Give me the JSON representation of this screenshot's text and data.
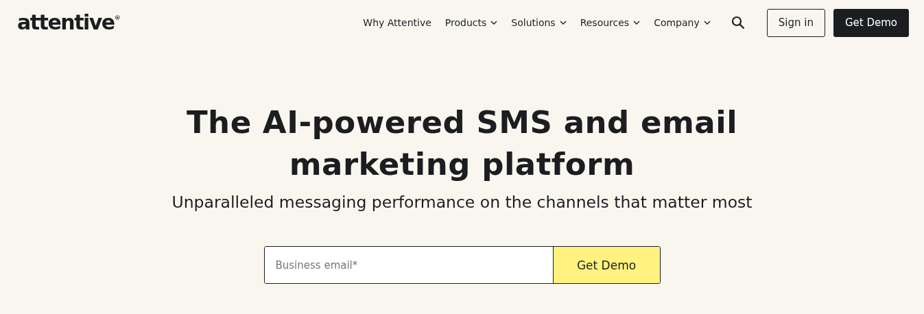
{
  "logo": "attentive$^{®}$",
  "nav": [
    {
      "label": "Why Attentive",
      "has_menu": false
    },
    {
      "label": "Products",
      "has_menu": true
    },
    {
      "label": "Solutions",
      "has_menu": true
    },
    {
      "label": "Resources",
      "has_menu": true
    },
    {
      "label": "Company",
      "has_menu": true
    }
  ],
  "header_buttons": [
    {
      "label": "Sign in",
      "kind": "outline"
    },
    {
      "label": "Get Demo",
      "kind": "dark"
    }
  ],
  "hero": {
    "title": "The AI-powered SMS and email marketing platform",
    "subtitle": "Unparalleled messaging performance on the channels that matter most"
  },
  "signup": {
    "placeholder": "Business email*",
    "button": "Get Demo"
  }
}
